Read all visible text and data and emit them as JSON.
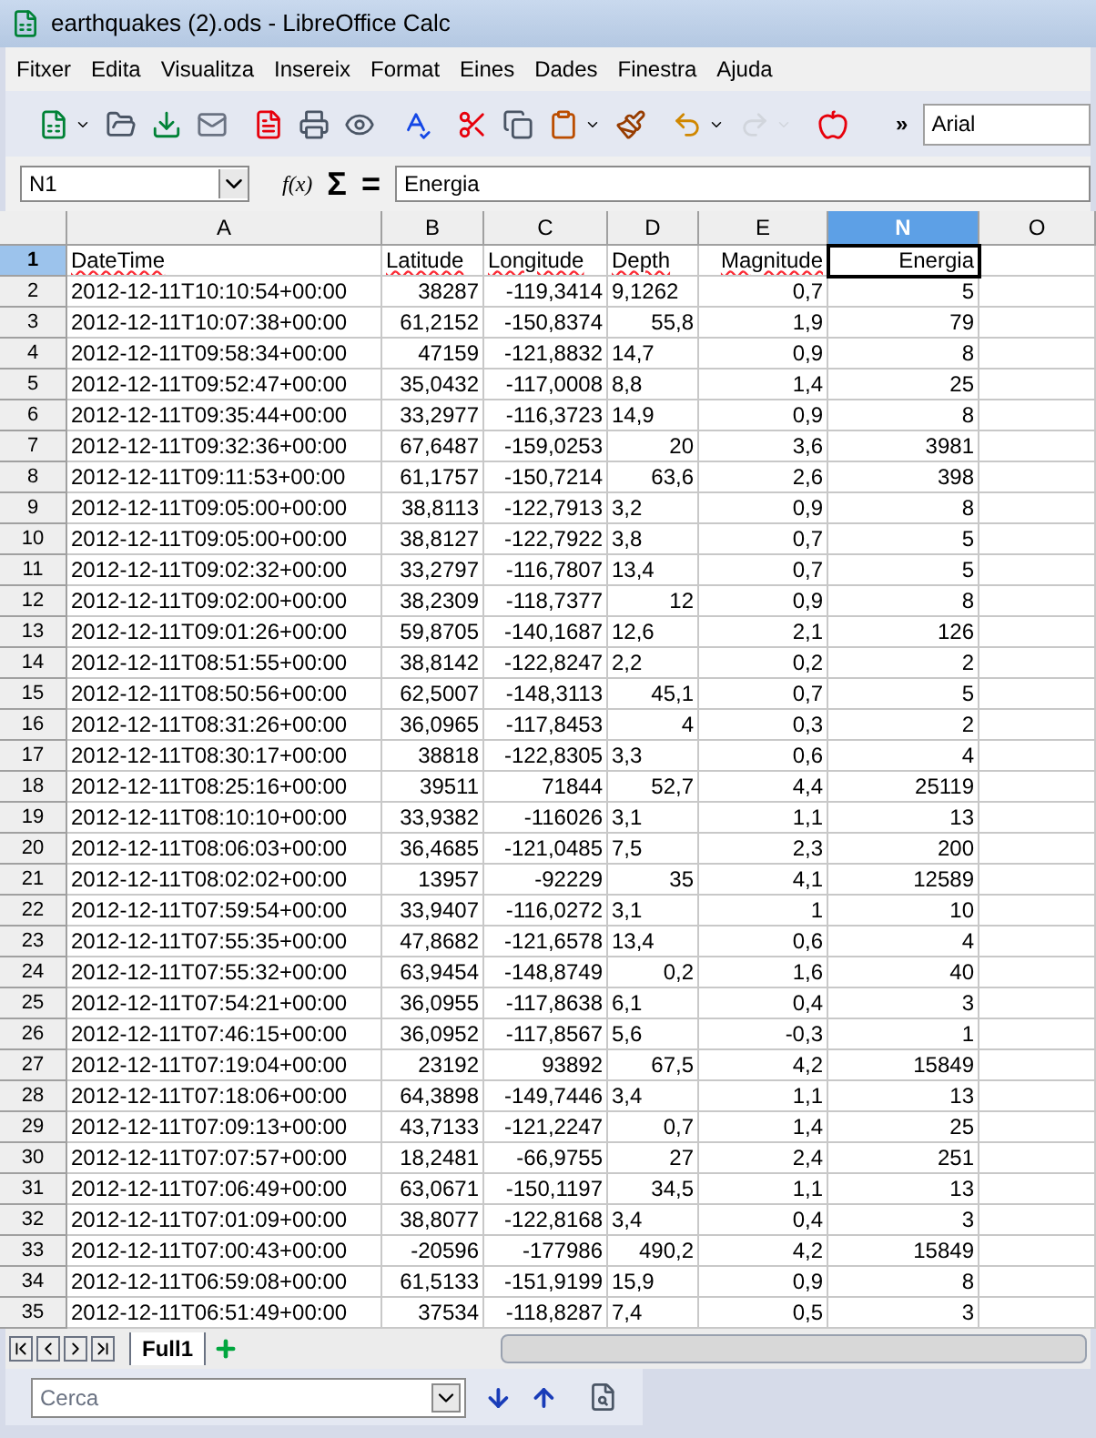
{
  "window": {
    "title": "earthquakes (2).ods - LibreOffice Calc"
  },
  "menu": [
    "Fitxer",
    "Edita",
    "Visualitza",
    "Insereix",
    "Format",
    "Eines",
    "Dades",
    "Finestra",
    "Ajuda"
  ],
  "toolbar": {
    "overflow": "»",
    "font_name": "Arial"
  },
  "formula_bar": {
    "name_box": "N1",
    "function_wizard": "f(x)",
    "sum": "Σ",
    "equals": "=",
    "content": "Energia"
  },
  "columns": [
    {
      "label": "A",
      "selected": false
    },
    {
      "label": "B",
      "selected": false
    },
    {
      "label": "C",
      "selected": false
    },
    {
      "label": "D",
      "selected": false
    },
    {
      "label": "E",
      "selected": false
    },
    {
      "label": "N",
      "selected": true
    },
    {
      "label": "O",
      "selected": false
    }
  ],
  "header_row": {
    "number": "1",
    "selected": true,
    "cells": [
      {
        "text": "DateTime",
        "right_aligned": false,
        "spellcheck_error": true,
        "selected": false
      },
      {
        "text": "Latitude",
        "right_aligned": false,
        "spellcheck_error": true,
        "selected": false
      },
      {
        "text": "Longitude",
        "right_aligned": false,
        "spellcheck_error": true,
        "selected": false
      },
      {
        "text": "Depth",
        "right_aligned": false,
        "spellcheck_error": true,
        "selected": false
      },
      {
        "text": "Magnitude",
        "right_aligned": true,
        "spellcheck_error": true,
        "selected": false
      },
      {
        "text": "Energia",
        "right_aligned": true,
        "spellcheck_error": false,
        "selected": true
      }
    ]
  },
  "rows": [
    {
      "number": "2",
      "depth_right_aligned": false,
      "cells": [
        "2012-12-11T10:10:54+00:00",
        "38287",
        "-119,3414",
        "9,1262",
        "0,7",
        "5"
      ]
    },
    {
      "number": "3",
      "depth_right_aligned": true,
      "cells": [
        "2012-12-11T10:07:38+00:00",
        "61,2152",
        "-150,8374",
        "55,8",
        "1,9",
        "79"
      ]
    },
    {
      "number": "4",
      "depth_right_aligned": false,
      "cells": [
        "2012-12-11T09:58:34+00:00",
        "47159",
        "-121,8832",
        "14,7",
        "0,9",
        "8"
      ]
    },
    {
      "number": "5",
      "depth_right_aligned": false,
      "cells": [
        "2012-12-11T09:52:47+00:00",
        "35,0432",
        "-117,0008",
        "8,8",
        "1,4",
        "25"
      ]
    },
    {
      "number": "6",
      "depth_right_aligned": false,
      "cells": [
        "2012-12-11T09:35:44+00:00",
        "33,2977",
        "-116,3723",
        "14,9",
        "0,9",
        "8"
      ]
    },
    {
      "number": "7",
      "depth_right_aligned": true,
      "cells": [
        "2012-12-11T09:32:36+00:00",
        "67,6487",
        "-159,0253",
        "20",
        "3,6",
        "3981"
      ]
    },
    {
      "number": "8",
      "depth_right_aligned": true,
      "cells": [
        "2012-12-11T09:11:53+00:00",
        "61,1757",
        "-150,7214",
        "63,6",
        "2,6",
        "398"
      ]
    },
    {
      "number": "9",
      "depth_right_aligned": false,
      "cells": [
        "2012-12-11T09:05:00+00:00",
        "38,8113",
        "-122,7913",
        "3,2",
        "0,9",
        "8"
      ]
    },
    {
      "number": "10",
      "depth_right_aligned": false,
      "cells": [
        "2012-12-11T09:05:00+00:00",
        "38,8127",
        "-122,7922",
        "3,8",
        "0,7",
        "5"
      ]
    },
    {
      "number": "11",
      "depth_right_aligned": false,
      "cells": [
        "2012-12-11T09:02:32+00:00",
        "33,2797",
        "-116,7807",
        "13,4",
        "0,7",
        "5"
      ]
    },
    {
      "number": "12",
      "depth_right_aligned": true,
      "cells": [
        "2012-12-11T09:02:00+00:00",
        "38,2309",
        "-118,7377",
        "12",
        "0,9",
        "8"
      ]
    },
    {
      "number": "13",
      "depth_right_aligned": false,
      "cells": [
        "2012-12-11T09:01:26+00:00",
        "59,8705",
        "-140,1687",
        "12,6",
        "2,1",
        "126"
      ]
    },
    {
      "number": "14",
      "depth_right_aligned": false,
      "cells": [
        "2012-12-11T08:51:55+00:00",
        "38,8142",
        "-122,8247",
        "2,2",
        "0,2",
        "2"
      ]
    },
    {
      "number": "15",
      "depth_right_aligned": true,
      "cells": [
        "2012-12-11T08:50:56+00:00",
        "62,5007",
        "-148,3113",
        "45,1",
        "0,7",
        "5"
      ]
    },
    {
      "number": "16",
      "depth_right_aligned": true,
      "cells": [
        "2012-12-11T08:31:26+00:00",
        "36,0965",
        "-117,8453",
        "4",
        "0,3",
        "2"
      ]
    },
    {
      "number": "17",
      "depth_right_aligned": false,
      "cells": [
        "2012-12-11T08:30:17+00:00",
        "38818",
        "-122,8305",
        "3,3",
        "0,6",
        "4"
      ]
    },
    {
      "number": "18",
      "depth_right_aligned": true,
      "cells": [
        "2012-12-11T08:25:16+00:00",
        "39511",
        "71844",
        "52,7",
        "4,4",
        "25119"
      ]
    },
    {
      "number": "19",
      "depth_right_aligned": false,
      "cells": [
        "2012-12-11T08:10:10+00:00",
        "33,9382",
        "-116026",
        "3,1",
        "1,1",
        "13"
      ]
    },
    {
      "number": "20",
      "depth_right_aligned": false,
      "cells": [
        "2012-12-11T08:06:03+00:00",
        "36,4685",
        "-121,0485",
        "7,5",
        "2,3",
        "200"
      ]
    },
    {
      "number": "21",
      "depth_right_aligned": true,
      "cells": [
        "2012-12-11T08:02:02+00:00",
        "13957",
        "-92229",
        "35",
        "4,1",
        "12589"
      ]
    },
    {
      "number": "22",
      "depth_right_aligned": false,
      "cells": [
        "2012-12-11T07:59:54+00:00",
        "33,9407",
        "-116,0272",
        "3,1",
        "1",
        "10"
      ]
    },
    {
      "number": "23",
      "depth_right_aligned": false,
      "cells": [
        "2012-12-11T07:55:35+00:00",
        "47,8682",
        "-121,6578",
        "13,4",
        "0,6",
        "4"
      ]
    },
    {
      "number": "24",
      "depth_right_aligned": true,
      "cells": [
        "2012-12-11T07:55:32+00:00",
        "63,9454",
        "-148,8749",
        "0,2",
        "1,6",
        "40"
      ]
    },
    {
      "number": "25",
      "depth_right_aligned": false,
      "cells": [
        "2012-12-11T07:54:21+00:00",
        "36,0955",
        "-117,8638",
        "6,1",
        "0,4",
        "3"
      ]
    },
    {
      "number": "26",
      "depth_right_aligned": false,
      "cells": [
        "2012-12-11T07:46:15+00:00",
        "36,0952",
        "-117,8567",
        "5,6",
        "-0,3",
        "1"
      ]
    },
    {
      "number": "27",
      "depth_right_aligned": true,
      "cells": [
        "2012-12-11T07:19:04+00:00",
        "23192",
        "93892",
        "67,5",
        "4,2",
        "15849"
      ]
    },
    {
      "number": "28",
      "depth_right_aligned": false,
      "cells": [
        "2012-12-11T07:18:06+00:00",
        "64,3898",
        "-149,7446",
        "3,4",
        "1,1",
        "13"
      ]
    },
    {
      "number": "29",
      "depth_right_aligned": true,
      "cells": [
        "2012-12-11T07:09:13+00:00",
        "43,7133",
        "-121,2247",
        "0,7",
        "1,4",
        "25"
      ]
    },
    {
      "number": "30",
      "depth_right_aligned": true,
      "cells": [
        "2012-12-11T07:07:57+00:00",
        "18,2481",
        "-66,9755",
        "27",
        "2,4",
        "251"
      ]
    },
    {
      "number": "31",
      "depth_right_aligned": true,
      "cells": [
        "2012-12-11T07:06:49+00:00",
        "63,0671",
        "-150,1197",
        "34,5",
        "1,1",
        "13"
      ]
    },
    {
      "number": "32",
      "depth_right_aligned": false,
      "cells": [
        "2012-12-11T07:01:09+00:00",
        "38,8077",
        "-122,8168",
        "3,4",
        "0,4",
        "3"
      ]
    },
    {
      "number": "33",
      "depth_right_aligned": true,
      "cells": [
        "2012-12-11T07:00:43+00:00",
        "-20596",
        "-177986",
        "490,2",
        "4,2",
        "15849"
      ]
    },
    {
      "number": "34",
      "depth_right_aligned": false,
      "cells": [
        "2012-12-11T06:59:08+00:00",
        "61,5133",
        "-151,9199",
        "15,9",
        "0,9",
        "8"
      ]
    },
    {
      "number": "35",
      "depth_right_aligned": false,
      "cells": [
        "2012-12-11T06:51:49+00:00",
        "37534",
        "-118,8287",
        "7,4",
        "0,5",
        "3"
      ]
    }
  ],
  "sheet_tabs": [
    {
      "label": "Full1",
      "selected": true
    }
  ],
  "find_bar": {
    "placeholder": "Cerca"
  }
}
